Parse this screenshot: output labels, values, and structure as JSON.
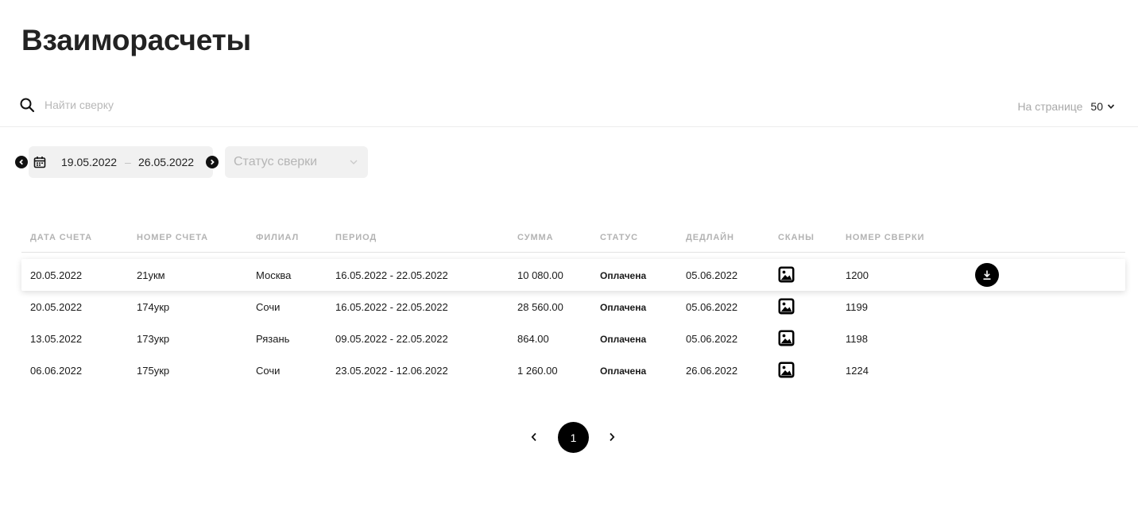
{
  "page": {
    "title": "Взаиморасчеты"
  },
  "search": {
    "placeholder": "Найти сверку"
  },
  "per_page": {
    "label": "На странице",
    "value": "50"
  },
  "filters": {
    "date_from": "19.05.2022",
    "date_separator": "–",
    "date_to": "26.05.2022",
    "status_placeholder": "Статус сверки"
  },
  "table": {
    "headers": [
      "Дата счета",
      "Номер счета",
      "Филиал",
      "Период",
      "Сумма",
      "Статус",
      "Дедлайн",
      "Сканы",
      "Номер сверки"
    ],
    "rows": [
      {
        "date": "20.05.2022",
        "number": "21укм",
        "branch": "Москва",
        "period": "16.05.2022 - 22.05.2022",
        "sum": "10 080.00",
        "status": "Оплачена",
        "deadline": "05.06.2022",
        "reconciliation": "1200"
      },
      {
        "date": "20.05.2022",
        "number": "174укр",
        "branch": "Сочи",
        "period": "16.05.2022 - 22.05.2022",
        "sum": "28 560.00",
        "status": "Оплачена",
        "deadline": "05.06.2022",
        "reconciliation": "1199"
      },
      {
        "date": "13.05.2022",
        "number": "173укр",
        "branch": "Рязань",
        "period": "09.05.2022 - 22.05.2022",
        "sum": "864.00",
        "status": "Оплачена",
        "deadline": "05.06.2022",
        "reconciliation": "1198"
      },
      {
        "date": "06.06.2022",
        "number": "175укр",
        "branch": "Сочи",
        "period": "23.05.2022 - 12.06.2022",
        "sum": "1 260.00",
        "status": "Оплачена",
        "deadline": "26.06.2022",
        "reconciliation": "1224"
      }
    ]
  },
  "pagination": {
    "current_page": "1"
  },
  "icons": {
    "search": "search-icon",
    "per_page_chevron": "chevron-down-icon",
    "date_prev": "chevron-left-circle-icon",
    "date_next": "chevron-right-circle-icon",
    "calendar": "calendar-icon",
    "status_chevron": "chevron-down-icon",
    "scan": "image-icon",
    "download": "download-icon",
    "pager_prev": "chevron-left-icon",
    "pager_next": "chevron-right-icon"
  },
  "colors": {
    "accent": "#000000",
    "muted_text": "#b3b3b3",
    "filter_bg": "#f1f1f1"
  }
}
